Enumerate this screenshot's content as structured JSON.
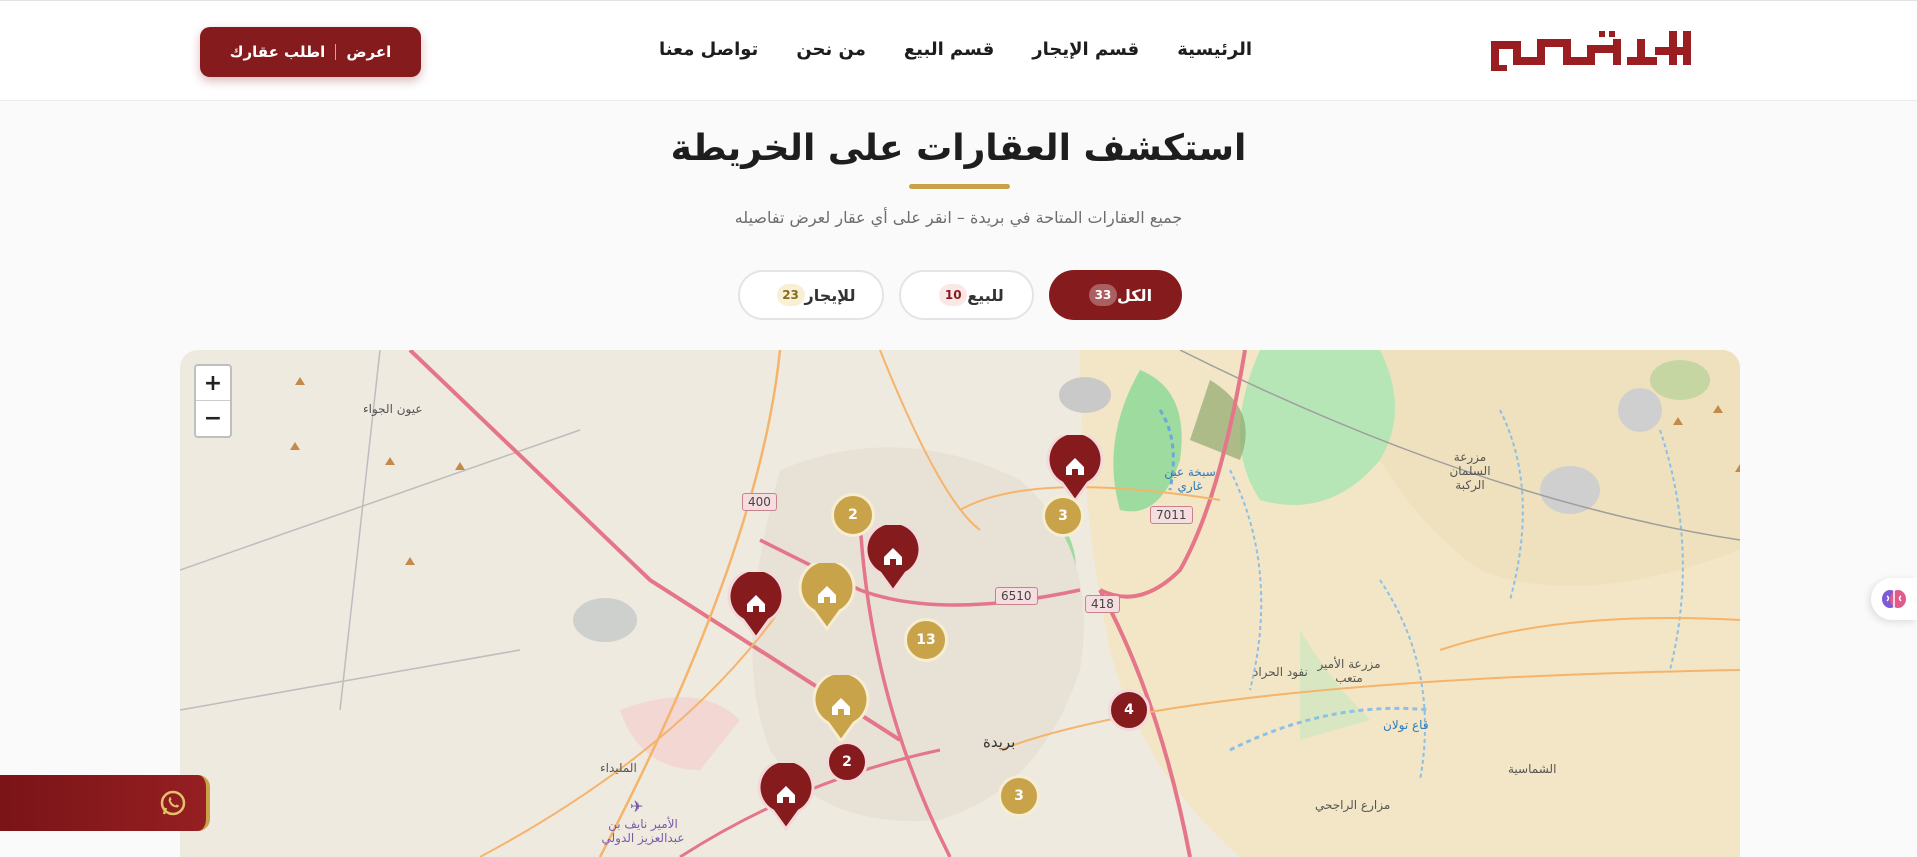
{
  "header": {
    "logo_text": "المشورة",
    "nav": [
      {
        "label": "الرئيسية"
      },
      {
        "label": "قسم الإيجار"
      },
      {
        "label": "قسم البيع"
      },
      {
        "label": "من نحن"
      },
      {
        "label": "تواصل معنا"
      }
    ],
    "cta": {
      "offer": "اعرض",
      "request": "اطلب عقارك"
    }
  },
  "section": {
    "title": "استكشف العقارات على الخريطة",
    "subtitle": "جميع العقارات المتاحة في بريدة – انقر على أي عقار لعرض تفاصيله"
  },
  "filters": {
    "all": {
      "label": "الكل",
      "count": "33"
    },
    "sale": {
      "label": "للبيع",
      "count": "10"
    },
    "rent": {
      "label": "للإيجار",
      "count": "23"
    }
  },
  "map": {
    "zoom_in": "+",
    "zoom_out": "−",
    "labels": {
      "uyun": "عيون الجواء",
      "buraydah": "بريدة",
      "mulaida": "المليداء",
      "airport": "الأمير نايف بن عبدالعزيز الدولي",
      "nafud": "نفود الحراد",
      "shimasiya": "الشماسية",
      "salman": "مزرعة السلمان الركبة",
      "amir_farm": "مزرعة الأمير متعب",
      "rajhi": "مزارع الراجحي",
      "sabkha": "سبخة عين غاري",
      "qa": "قاع تولان"
    },
    "roads": [
      "400",
      "7011",
      "6510",
      "418"
    ],
    "clusters": [
      "2",
      "3",
      "13",
      "4",
      "2",
      "3"
    ]
  },
  "colors": {
    "primary": "#861b1e",
    "gold": "#c9a34a"
  }
}
